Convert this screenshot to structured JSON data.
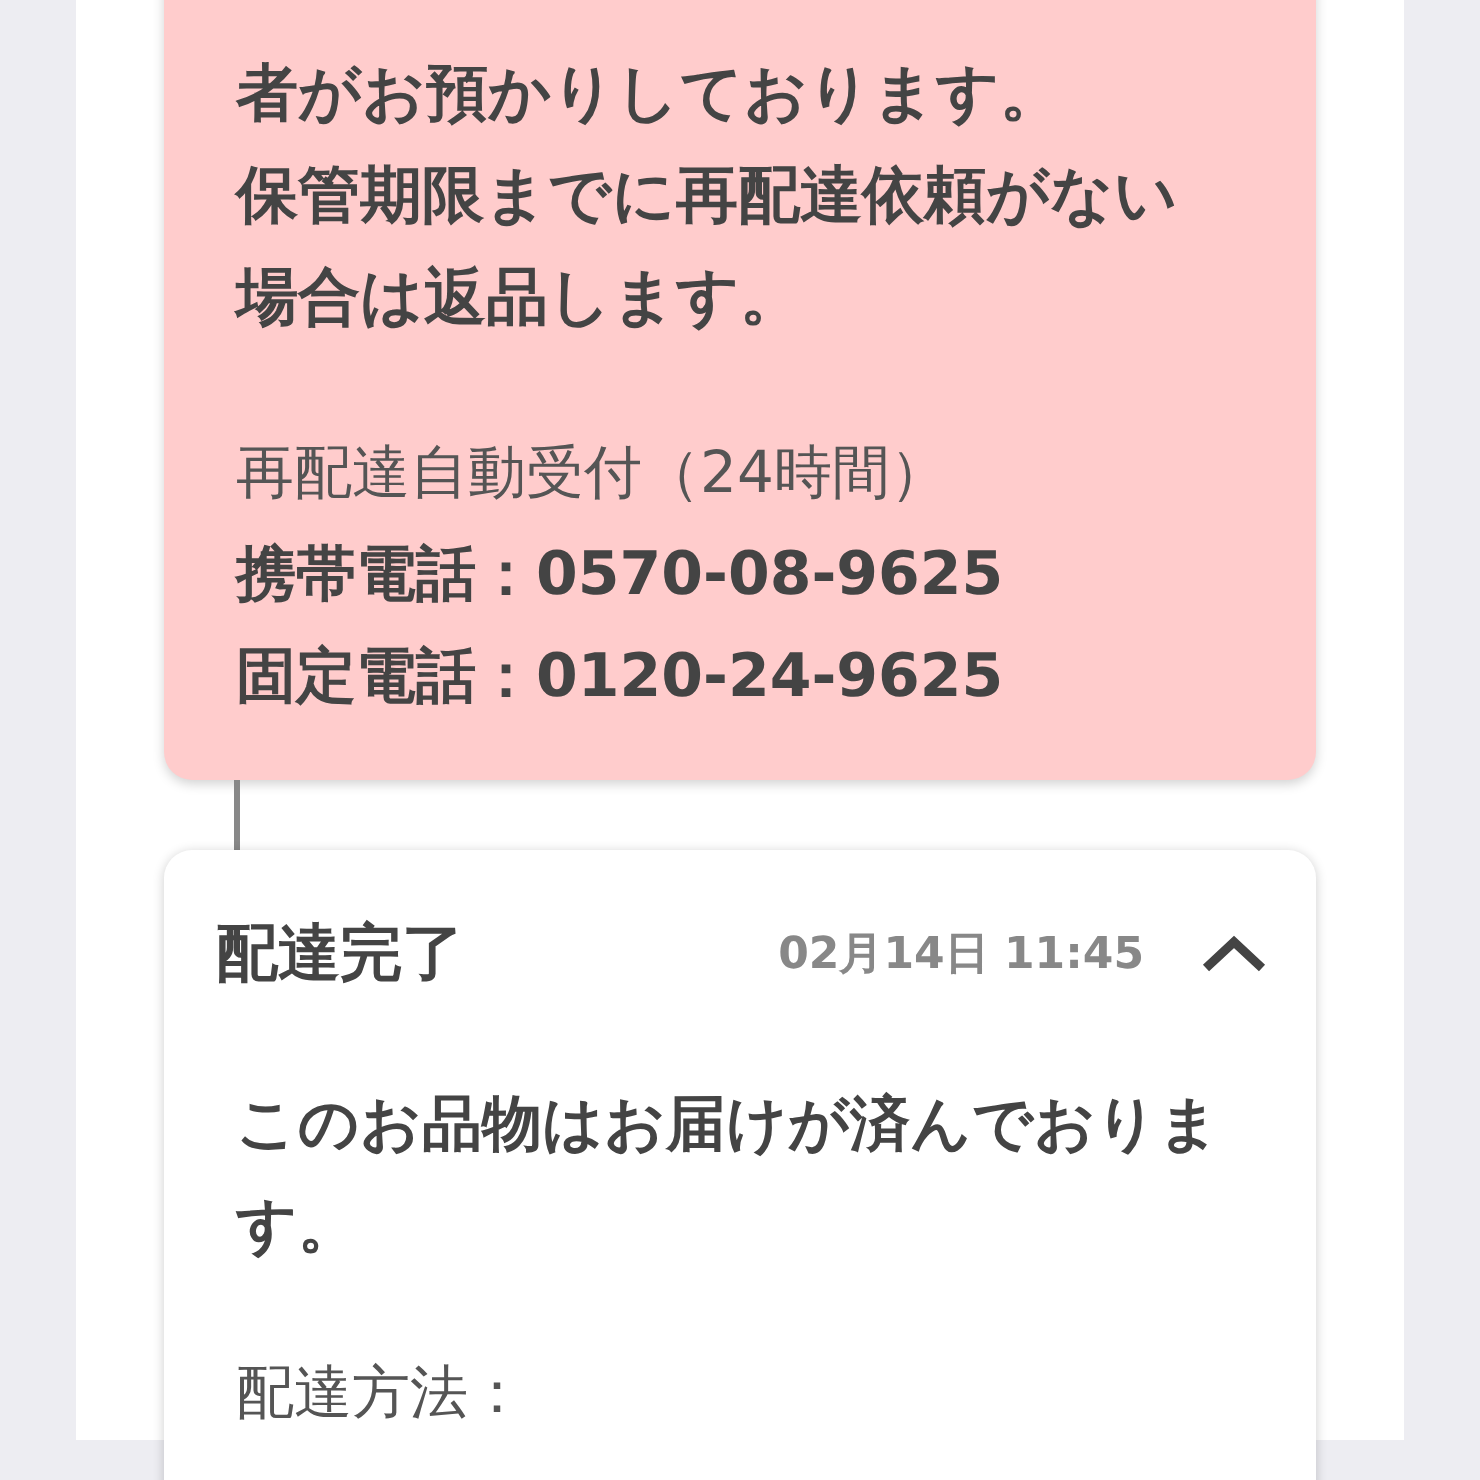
{
  "notice_card": {
    "lines": [
      "者がお預かりしております。",
      "保管期限までに再配達依頼がない場合は返品します。"
    ],
    "redelivery_label": "再配達自動受付（24時間）",
    "phones": [
      "携帯電話：0570-08-9625",
      "固定電話：0120-24-9625"
    ]
  },
  "status_card": {
    "title": "配達完了",
    "timestamp": "02月14日 11:45",
    "expanded": true,
    "message": "このお品物はお届けが済んでおります。",
    "method_label": "配達方法："
  }
}
